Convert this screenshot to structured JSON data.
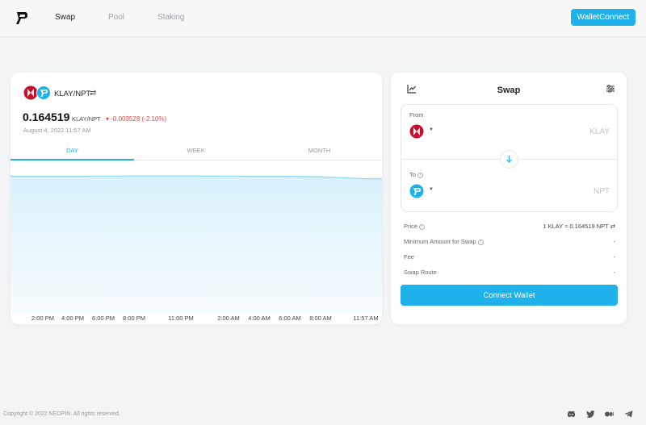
{
  "nav": {
    "items": [
      "Swap",
      "Pool",
      "Staking"
    ],
    "wallet_connect": "WalletConnect"
  },
  "chart_panel": {
    "pair": "KLAY/NPT",
    "swap_glyph": "⇄",
    "price": "0.164519",
    "price_unit": "KLAY/NPT",
    "change": "▾ -0.003528 (-2.10%)",
    "date": "August 4, 2022 11:57 AM",
    "tabs": [
      "DAY",
      "WEEK",
      "MONTH"
    ]
  },
  "chart_data": {
    "type": "area",
    "x": [
      "2:00 PM",
      "4:00 PM",
      "6:00 PM",
      "8:00 PM",
      "11:00 PM",
      "2:00 AM",
      "4:00 AM",
      "6:00 AM",
      "8:00 AM",
      "11:57 AM"
    ],
    "y": [
      0.1675,
      0.1676,
      0.1677,
      0.1678,
      0.1678,
      0.1677,
      0.1676,
      0.1674,
      0.1668,
      0.164519
    ],
    "ylim": [
      0,
      0.168
    ],
    "color": "#8fd6f2",
    "fill": "#e0f4fc"
  },
  "swap": {
    "title": "Swap",
    "from_label": "From",
    "from_token": "KLAY",
    "to_label": "To",
    "to_token": "NPT",
    "rows": [
      {
        "label": "Price",
        "value": "1 KLAY ≈ 0.164519 NPT ⇄"
      },
      {
        "label": "Minimum Amount for Swap",
        "value": "-"
      },
      {
        "label": "Fee",
        "value": "-"
      },
      {
        "label": "Swap Route",
        "value": "-"
      }
    ],
    "connect_button": "Connect Wallet"
  },
  "footer": {
    "copyright": "Copyright © 2022 NEOPIN. All rights reserved.",
    "social": [
      "discord-icon",
      "twitter-icon",
      "medium-icon",
      "telegram-icon"
    ]
  },
  "colors": {
    "accent": "#1eb1ea",
    "negative": "#e04646",
    "klay": "#c8102e"
  }
}
